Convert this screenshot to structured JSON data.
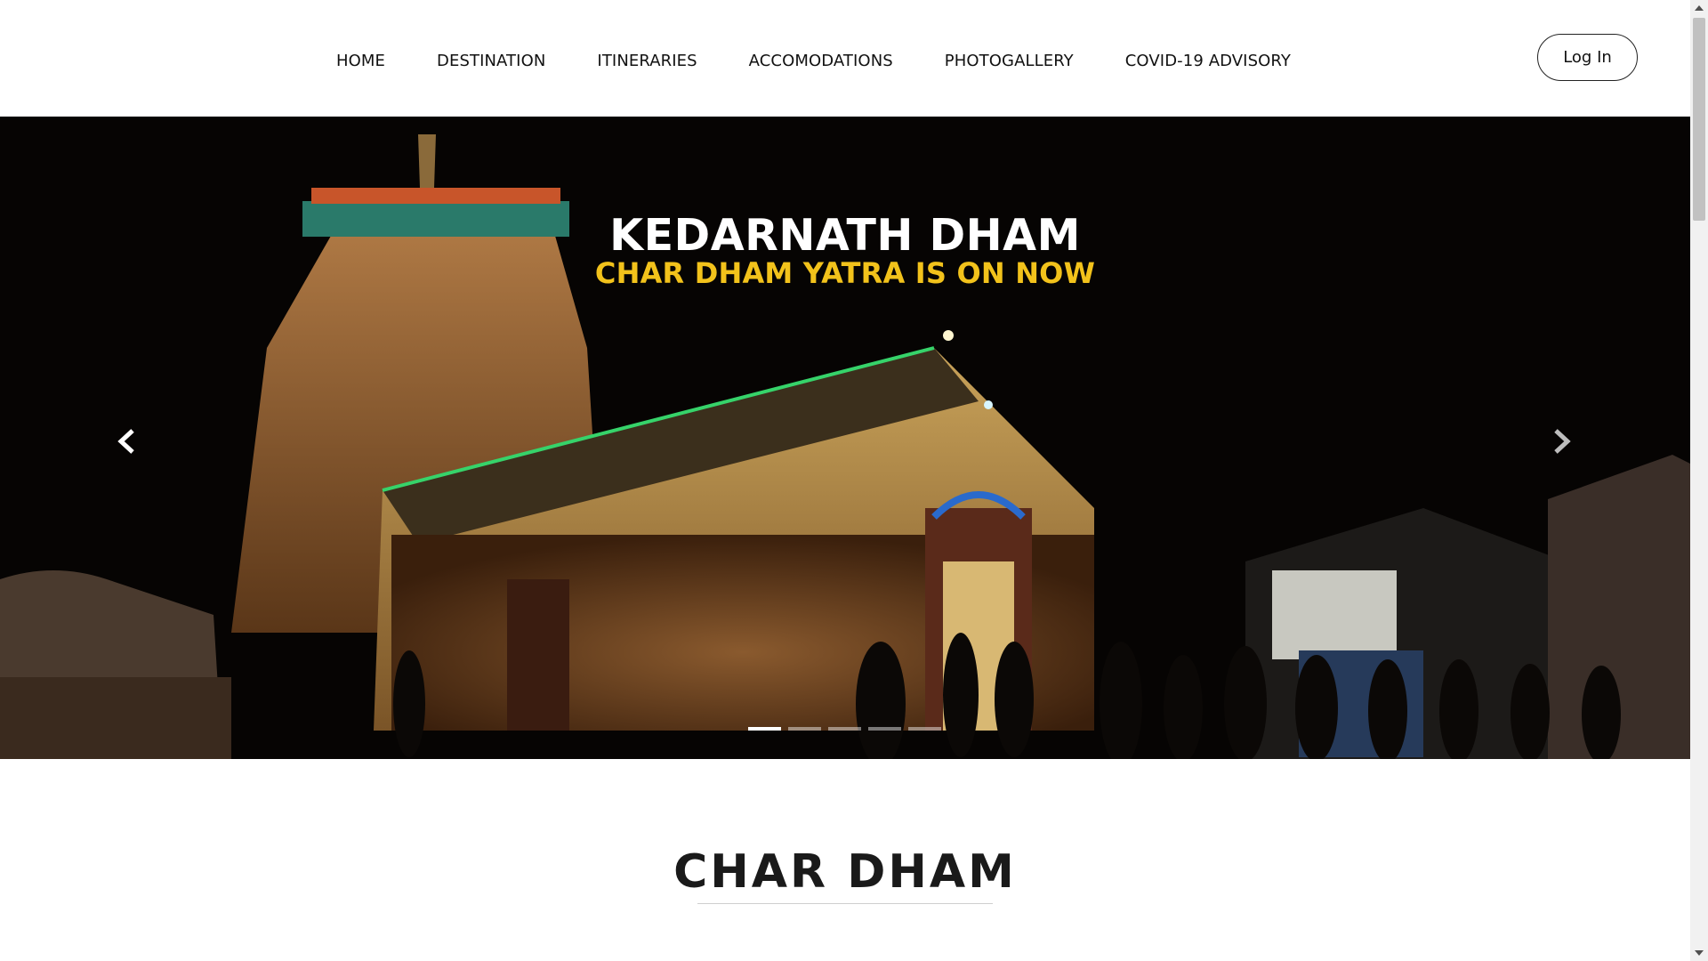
{
  "nav": {
    "items": [
      {
        "label": "HOME"
      },
      {
        "label": "DESTINATION"
      },
      {
        "label": "ITINERARIES"
      },
      {
        "label": "ACCOMODATIONS"
      },
      {
        "label": "PHOTOGALLERY"
      },
      {
        "label": "COVID-19 ADVISORY"
      }
    ],
    "login_label": "Log In"
  },
  "hero": {
    "title": "KEDARNATH DHAM",
    "subtitle": "CHAR DHAM YATRA IS ON NOW",
    "prev_icon": "chevron-left-icon",
    "next_icon": "chevron-right-icon",
    "slide_count": 5,
    "active_slide": 1,
    "colors": {
      "title": "#ffffff",
      "subtitle": "#f2c21b",
      "sky": "#070504"
    }
  },
  "section": {
    "title": "CHAR DHAM"
  }
}
